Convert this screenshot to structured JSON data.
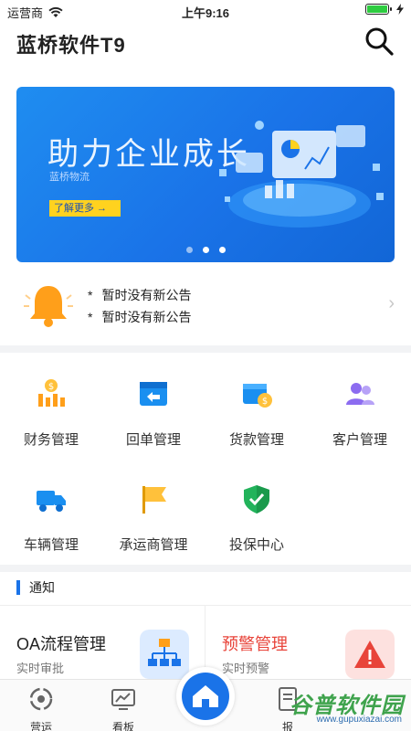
{
  "status_bar": {
    "carrier": "运营商",
    "time": "上午9:16"
  },
  "header": {
    "title": "蓝桥软件T9"
  },
  "banner": {
    "title": "助力企业成长",
    "subtitle": "蓝桥物流",
    "cta": "了解更多 →",
    "dots": 3,
    "active_dot": 0
  },
  "notice": {
    "lines": [
      "暂时没有新公告",
      "暂时没有新公告"
    ],
    "bullet": "*"
  },
  "menu": [
    {
      "label": "财务管理",
      "icon": "finance-icon"
    },
    {
      "label": "回单管理",
      "icon": "receipt-icon"
    },
    {
      "label": "货款管理",
      "icon": "payment-icon"
    },
    {
      "label": "客户管理",
      "icon": "customers-icon"
    },
    {
      "label": "车辆管理",
      "icon": "truck-icon"
    },
    {
      "label": "承运商管理",
      "icon": "flag-icon"
    },
    {
      "label": "投保中心",
      "icon": "shield-icon"
    }
  ],
  "section": {
    "title": "通知"
  },
  "cards": [
    {
      "title": "OA流程管理",
      "subtitle": "实时审批",
      "icon": "org-chart-icon"
    },
    {
      "title": "预警管理",
      "subtitle": "实时预警",
      "icon": "warning-icon"
    }
  ],
  "tabs": [
    {
      "label": "营运",
      "icon": "operation-icon"
    },
    {
      "label": "看板",
      "icon": "board-icon"
    },
    {
      "label": "",
      "icon": "home-icon"
    },
    {
      "label": "报",
      "icon": "report-icon"
    }
  ],
  "watermark": {
    "name": "谷普软件园",
    "url": "www.gupuxiazai.com"
  },
  "colors": {
    "primary": "#1a73e8",
    "accent": "#ffd21f",
    "warning": "#e8443a",
    "orange": "#ff9f1a"
  }
}
